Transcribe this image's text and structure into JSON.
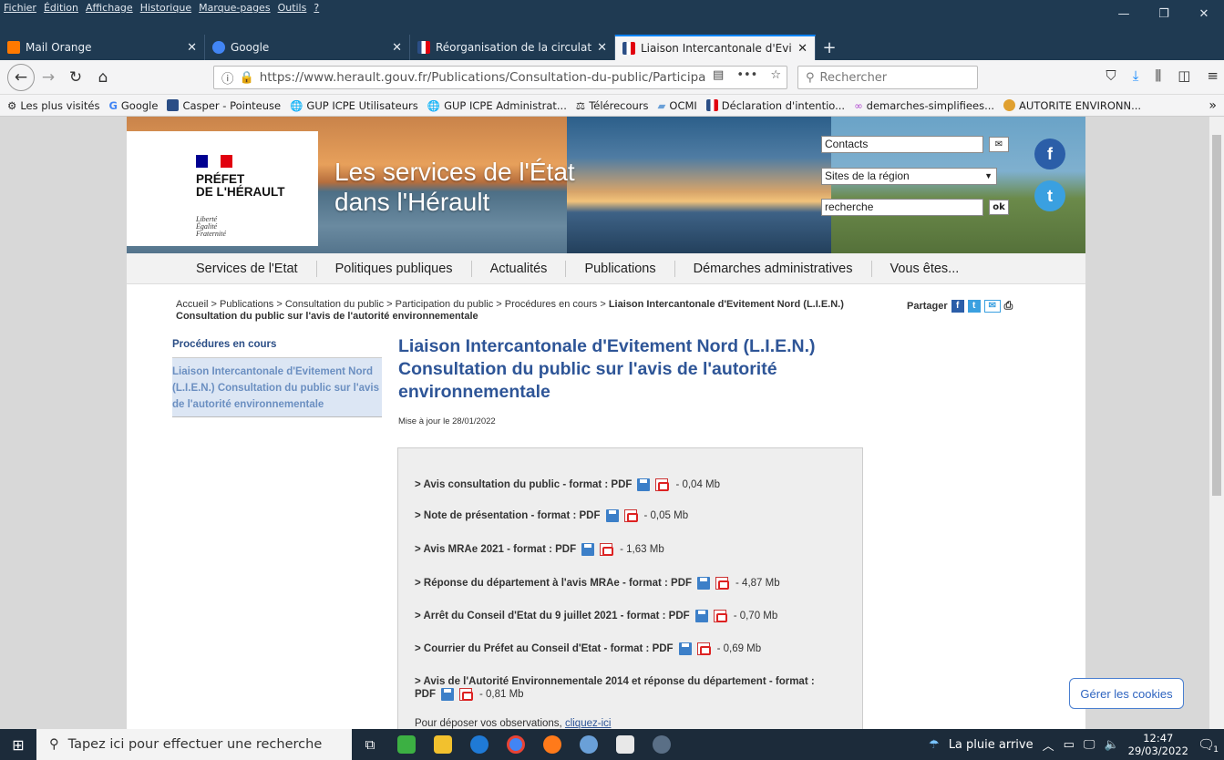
{
  "browser": {
    "menu": [
      "Fichier",
      "Édition",
      "Affichage",
      "Historique",
      "Marque-pages",
      "Outils",
      "?"
    ],
    "tabs": [
      {
        "label": "Mail Orange",
        "color": "#ff7900"
      },
      {
        "label": "Google",
        "color": "#4285f4"
      },
      {
        "label": "Réorganisation de la circulation",
        "color": "#2b4e86"
      },
      {
        "label": "Liaison Intercantonale d'Evitem",
        "color": "#2b4e86"
      }
    ],
    "url": "https://www.herault.gouv.fr/Publications/Consultation-du-public/Participa",
    "search_placeholder": "Rechercher",
    "bookmarks": [
      "Les plus visités",
      "Google",
      "Casper - Pointeuse",
      "GUP ICPE Utilisateurs",
      "GUP ICPE Administrat...",
      "Télérecours",
      "OCMI",
      "Déclaration d'intentio...",
      "demarches-simplifiees...",
      "AUTORITE ENVIRONN..."
    ]
  },
  "site": {
    "logo": {
      "line1": "PRÉFET",
      "line2": "DE L'HÉRAULT",
      "motto1": "Liberté",
      "motto2": "Égalité",
      "motto3": "Fraternité"
    },
    "banner_title_1": "Les services de l'État",
    "banner_title_2": "dans l'Hérault",
    "contacts": "Contacts",
    "sites_region": "Sites de la région",
    "recherche": "recherche",
    "ok": "ok",
    "nav": [
      "Services de l'Etat",
      "Politiques publiques",
      "Actualités",
      "Publications",
      "Démarches administratives",
      "Vous êtes..."
    ],
    "breadcrumb_plain": "Accueil > Publications > Consultation du public > Participation du public > Procédures en cours > ",
    "breadcrumb_current": "Liaison Intercantonale d'Evitement Nord (L.I.E.N.) Consultation du public sur l'avis de l'autorité environnementale",
    "share_label": "Partager",
    "sidebar_heading": "Procédures en cours",
    "sidebar_item": "Liaison Intercantonale d'Evitement Nord (L.I.E.N.) Consultation du public sur l'avis de l'autorité environnementale",
    "page_title": "Liaison Intercantonale d'Evitement Nord (L.I.E.N.) Consultation du public sur l'avis de l'autorité environnementale",
    "updated": "Mise à jour le 28/01/2022",
    "documents": [
      {
        "label": "> Avis consultation du public - format : PDF",
        "size": "- 0,04 Mb"
      },
      {
        "label": "> Note de présentation - format : PDF",
        "size": "- 0,05 Mb"
      },
      {
        "label": "> Avis MRAe 2021 - format : PDF",
        "size": "- 1,63 Mb"
      },
      {
        "label": "> Réponse du département à l'avis MRAe - format : PDF",
        "size": "- 4,87 Mb"
      },
      {
        "label": "> Arrêt du Conseil d'Etat du 9 juillet 2021 - format : PDF",
        "size": "- 0,70 Mb"
      },
      {
        "label": "> Courrier du Préfet au Conseil d'Etat - format : PDF",
        "size": "- 0,69 Mb"
      },
      {
        "label_line1": "> Avis de l'Autorité Environnementale 2014 et réponse du département - format :",
        "label_line2": "PDF",
        "size": "- 0,81 Mb"
      }
    ],
    "observations_text": "Pour déposer vos observations,",
    "observations_link": "cliquez-ici",
    "cookies_button": "Gérer les cookies"
  },
  "taskbar": {
    "search_placeholder": "Tapez ici pour effectuer une recherche",
    "weather": "La pluie arrive",
    "time": "12:47",
    "date": "29/03/2022",
    "notif_count": "1"
  },
  "colors": {
    "accent_blue": "#2e5597",
    "titlebar": "#1f3a52"
  }
}
